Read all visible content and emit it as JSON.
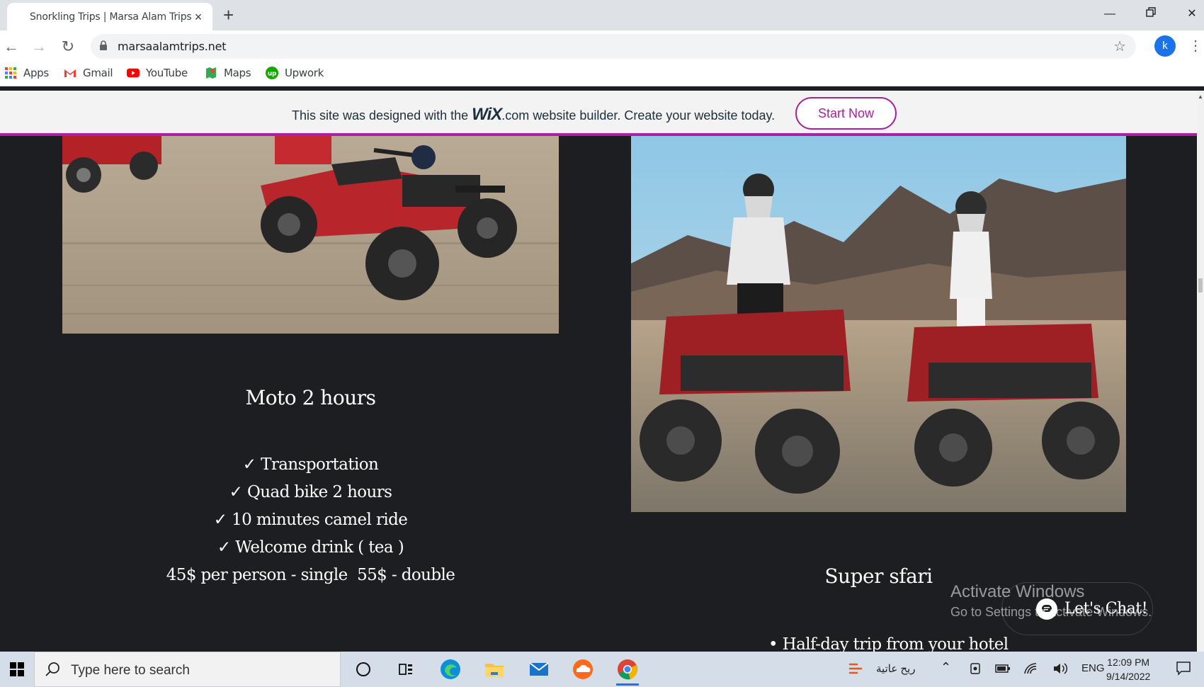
{
  "browser": {
    "tab_title": "Snorkling Trips | Marsa Alam Trips",
    "url": "marsaalamtrips.net",
    "profile_initial": "k",
    "bookmarks": [
      "Apps",
      "Gmail",
      "YouTube",
      "Maps",
      "Upwork"
    ]
  },
  "wix_banner": {
    "text_before": "This site was designed with the",
    "logo": "WiX",
    "logo_suffix": ".com",
    "text_after": "website builder. Create your website today.",
    "button_label": "Start Now",
    "accent": "#a8219e"
  },
  "page": {
    "left_card": {
      "title": "Moto 2 hours",
      "features": [
        "✓ Transportation",
        "✓ Quad bike 2 hours",
        "✓ 10 minutes camel ride",
        "✓ Welcome drink ( tea )"
      ],
      "price": "45$ per person - single  55$ - double"
    },
    "right_card": {
      "title": "Super sfari",
      "first_bullet": "• Half-day trip from your hotel"
    },
    "chat_label": "Let's Chat!",
    "background": "#1d1e22"
  },
  "windows_activation": {
    "title": "Activate Windows",
    "subtitle": "Go to Settings to activate Windows."
  },
  "taskbar": {
    "search_placeholder": "Type here to search",
    "weather_text": "ريح عاتية",
    "language": "ENG",
    "time": "12:09 PM",
    "date": "9/14/2022"
  }
}
